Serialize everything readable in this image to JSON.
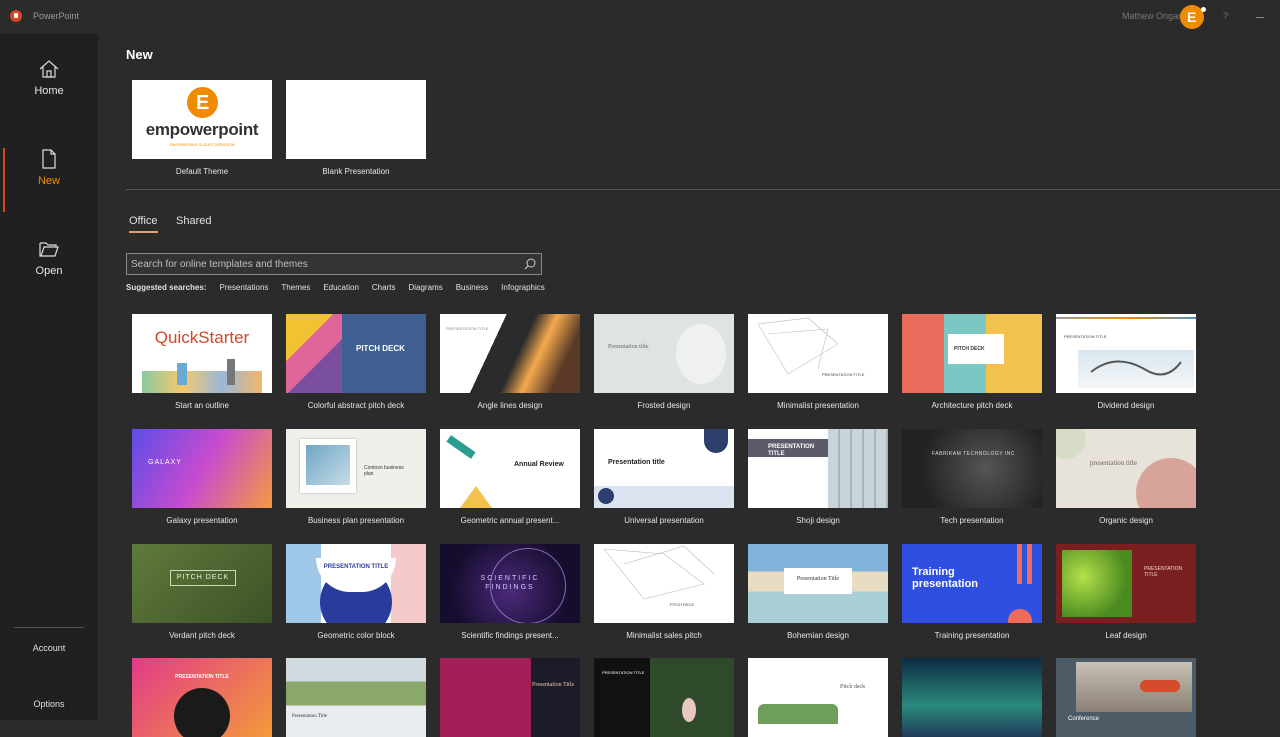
{
  "app": {
    "title": "PowerPoint",
    "user": "Mathew Ongaro",
    "help": "?"
  },
  "sidebar": {
    "items": [
      {
        "label": "Home",
        "icon": "home-icon"
      },
      {
        "label": "New",
        "icon": "new-file-icon",
        "active": true
      },
      {
        "label": "Open",
        "icon": "folder-open-icon"
      }
    ],
    "footer": [
      {
        "label": "Account"
      },
      {
        "label": "Options"
      }
    ]
  },
  "main": {
    "title": "New",
    "featured": [
      {
        "label": "Default Theme",
        "logo_text": "empowerpoint",
        "logo_tagline": "EMPOWERING SLIDES CREATION"
      },
      {
        "label": "Blank Presentation"
      }
    ],
    "tabs": [
      {
        "label": "Office",
        "active": true
      },
      {
        "label": "Shared"
      }
    ],
    "search": {
      "placeholder": "Search for online templates and themes"
    },
    "suggested": {
      "label": "Suggested searches:",
      "items": [
        "Presentations",
        "Themes",
        "Education",
        "Charts",
        "Diagrams",
        "Business",
        "Infographics"
      ]
    },
    "templates": [
      {
        "label": "Start an outline",
        "thumb": "QuickStarter"
      },
      {
        "label": "Colorful abstract pitch deck",
        "thumb": "PITCH DECK"
      },
      {
        "label": "Angle lines design",
        "thumb": "PRESENTATION TITLE"
      },
      {
        "label": "Frosted design",
        "thumb": "Presentation title"
      },
      {
        "label": "Minimalist presentation",
        "thumb": "PRESENTATION TITLE"
      },
      {
        "label": "Architecture pitch deck",
        "thumb": "PITCH DECK"
      },
      {
        "label": "Dividend design",
        "thumb": "PRESENTATION TITLE"
      },
      {
        "label": "Galaxy presentation",
        "thumb": "GALAXY"
      },
      {
        "label": "Business plan presentation",
        "thumb": "Contoso business plan"
      },
      {
        "label": "Geometric annual present...",
        "thumb": "Annual Review"
      },
      {
        "label": "Universal presentation",
        "thumb": "Presentation title"
      },
      {
        "label": "Shoji design",
        "thumb": "PRESENTATION TITLE"
      },
      {
        "label": "Tech presentation",
        "thumb": "FABRIKAM TECHNOLOGY INC"
      },
      {
        "label": "Organic design",
        "thumb": "presentation title"
      },
      {
        "label": "Verdant pitch deck",
        "thumb": "PITCH DECK"
      },
      {
        "label": "Geometric color block",
        "thumb": "PRESENTATION TITLE"
      },
      {
        "label": "Scientific findings present...",
        "thumb": "SCIENTIFIC FINDINGS"
      },
      {
        "label": "Minimalist sales pitch",
        "thumb": "PITCH DECK"
      },
      {
        "label": "Bohemian design",
        "thumb": "Presentation Title"
      },
      {
        "label": "Training presentation",
        "thumb": "Training presentation"
      },
      {
        "label": "Leaf design",
        "thumb": "PRESENTATION TITLE"
      },
      {
        "label": "",
        "thumb": "PRESENTATION TITLE"
      },
      {
        "label": "",
        "thumb": "Presentation Title"
      },
      {
        "label": "",
        "thumb": "Presentation Title"
      },
      {
        "label": "",
        "thumb": "PRESENTATION TITLE"
      },
      {
        "label": "",
        "thumb": "Pitch deck"
      },
      {
        "label": "",
        "thumb": ""
      },
      {
        "label": "",
        "thumb": "Conference"
      }
    ]
  }
}
